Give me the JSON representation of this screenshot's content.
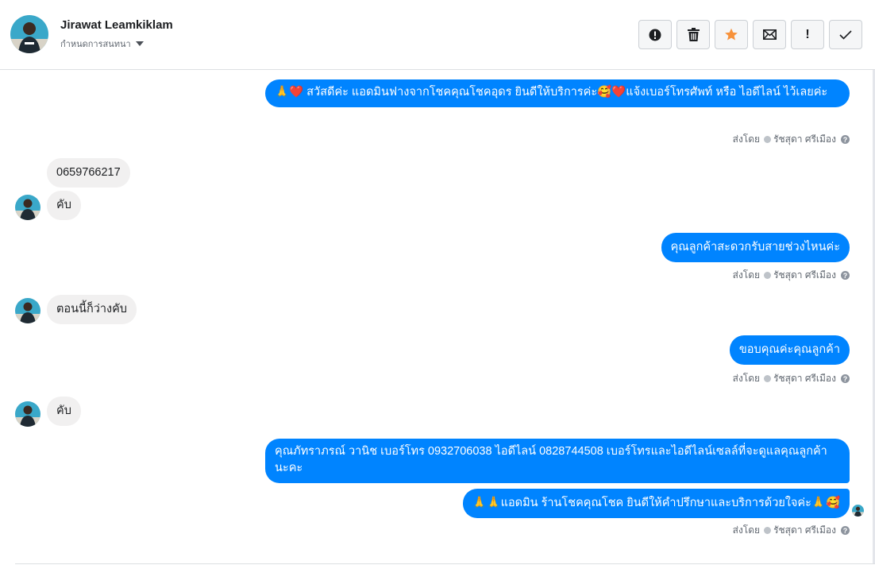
{
  "header": {
    "name": "Jirawat Leamkiklam",
    "subtitle": "กำหนดการสนทนา",
    "actions": [
      "spam-icon",
      "trash-icon",
      "star-icon",
      "mail-icon",
      "important-icon",
      "check-icon"
    ],
    "important_label": "!",
    "colors": {
      "star": "#f7923b",
      "border": "#ccd0d5"
    }
  },
  "messages": {
    "m1": "🙏❤️ สวัสดีค่ะ แอดมินฟางจากโชคคุณโชคอุดร ยินดีให้บริการค่ะ🥰❤️แจ้งเบอร์โทรศัพท์ หรือ ไอดีไลน์  ไว้เลยค่ะ",
    "m2": "0659766217",
    "m3": "คับ",
    "m4": "คุณลูกค้าสะดวกรับสายช่วงไหนค่ะ",
    "m5": "ตอนนี้ก็ว่างคับ",
    "m6": "ขอบคุณค่ะคุณลูกค้า",
    "m7": "คับ",
    "m8": "คุณภัทราภรณ์  วานิช      เบอร์โทร 0932706038  ไอดีไลน์ 0828744508   เบอร์โทรและไอดีไลน์เซลล์ที่จะดูแลคุณลูกค้านะคะ",
    "m9": "🙏🙏แอดมิน ร้านโชคคุณโชค ยินดีให้คำปรึกษาและบริการด้วยใจค่ะ🙏🥰"
  },
  "meta": {
    "sent_by": "ส่งโดย",
    "sender": "รัชสุดา ศรีเมือง",
    "help": "?"
  },
  "colors": {
    "outgoing": "#0084ff",
    "incoming": "#f1f0f0"
  }
}
